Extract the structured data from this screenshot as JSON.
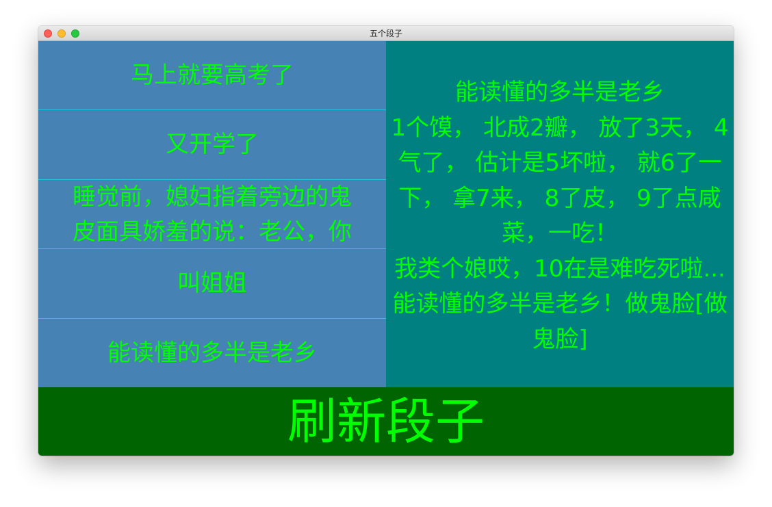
{
  "window": {
    "title": "五个段子"
  },
  "list": {
    "items": [
      {
        "text": "马上就要高考了"
      },
      {
        "text": "又开学了"
      },
      {
        "text": "睡觉前，媳妇指着旁边的鬼皮面具娇羞的说：老公，你"
      },
      {
        "text": "叫姐姐"
      },
      {
        "text": "能读懂的多半是老乡"
      }
    ]
  },
  "detail": {
    "text": "能读懂的多半是老乡\n1个馍， 北成2瓣， 放了3天， 4气了， 估计是5坏啦， 就6了一下， 拿7来， 8了皮， 9了点咸菜，一吃！\n我类个娘哎，10在是难吃死啦...\n能读懂的多半是老乡！做鬼脸[做鬼脸]"
  },
  "refresh_button": {
    "label": "刷新段子"
  },
  "colors": {
    "list_background": "#4682b4",
    "detail_background": "#008080",
    "button_background": "#006400",
    "text": "#00ff00",
    "separator": "#1fc4e6"
  }
}
